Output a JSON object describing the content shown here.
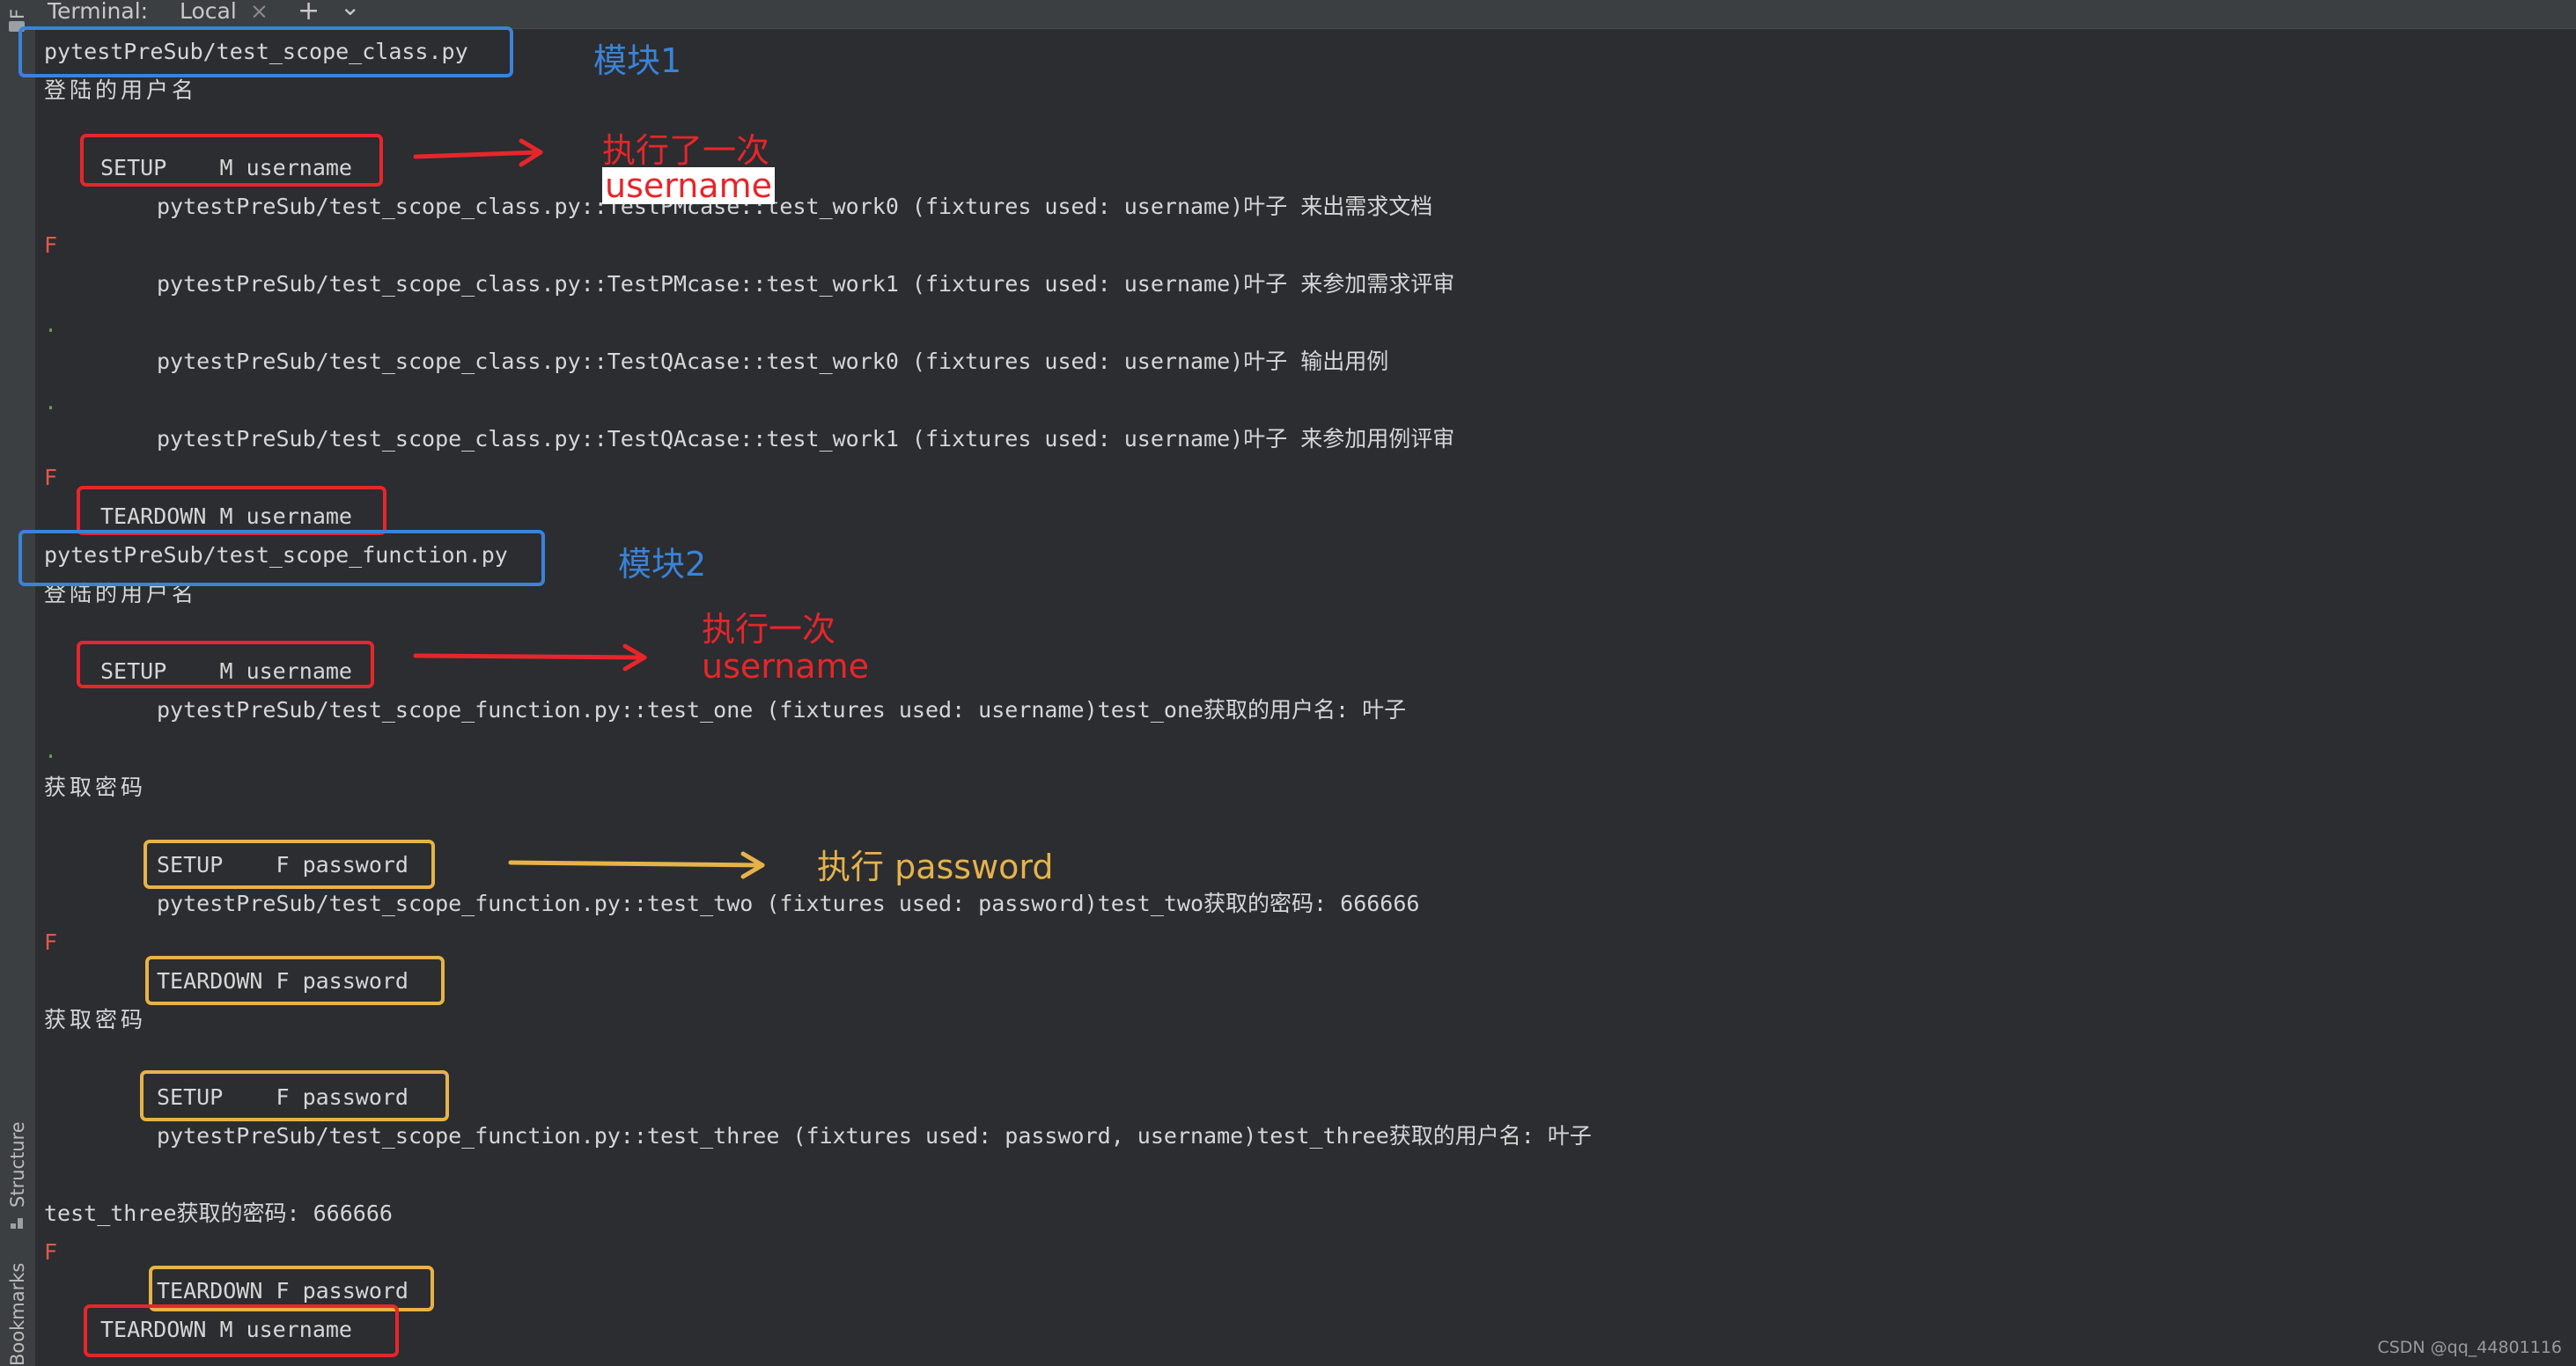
{
  "sidebar": {
    "top_label": "F",
    "structure_label": "Structure",
    "bookmarks_label": "Bookmarks"
  },
  "tool_tabs": {
    "terminal_label": "Terminal:",
    "local_tab_label": "Local",
    "close_glyph": "×",
    "add_glyph": "+",
    "dropdown_glyph": "⌄"
  },
  "terminal": {
    "line_module1": "pytestPreSub/test_scope_class.py",
    "line_login_user_1": "登陆的用户名",
    "line_setup_m_1": "SETUP    M username",
    "line_pm_work0": "pytestPreSub/test_scope_class.py::TestPMcase::test_work0 (fixtures used: username)叶子 来出需求文档",
    "line_f_1": "F",
    "line_pm_work1": "pytestPreSub/test_scope_class.py::TestPMcase::test_work1 (fixtures used: username)叶子 来参加需求评审",
    "line_dot_1": ".",
    "line_qa_work0": "pytestPreSub/test_scope_class.py::TestQAcase::test_work0 (fixtures used: username)叶子 输出用例",
    "line_dot_2": ".",
    "line_qa_work1": "pytestPreSub/test_scope_class.py::TestQAcase::test_work1 (fixtures used: username)叶子 来参加用例评审",
    "line_f_2": "F",
    "line_teardown_m_1": "TEARDOWN M username",
    "line_module2": "pytestPreSub/test_scope_function.py",
    "line_login_user_2": "登陆的用户名",
    "line_setup_m_2": "SETUP    M username",
    "line_test_one": "pytestPreSub/test_scope_function.py::test_one (fixtures used: username)test_one获取的用户名: 叶子",
    "line_dot_3": ".",
    "line_get_pwd_1": "获取密码",
    "line_setup_f_1": "SETUP    F password",
    "line_test_two": "pytestPreSub/test_scope_function.py::test_two (fixtures used: password)test_two获取的密码: 666666",
    "line_f_3": "F",
    "line_teardown_f_1": "TEARDOWN F password",
    "line_get_pwd_2": "获取密码",
    "line_setup_f_2": "SETUP    F password",
    "line_test_three": "pytestPreSub/test_scope_function.py::test_three (fixtures used: password, username)test_three获取的用户名: 叶子",
    "line_three_pwd": "test_three获取的密码: 666666",
    "line_f_4": "F",
    "line_teardown_f_2": "TEARDOWN F password",
    "line_teardown_m_2": "TEARDOWN M username"
  },
  "annotations": {
    "module1": "模块1",
    "module2": "模块2",
    "executed_once_1": "执行了一次",
    "username_1": "username",
    "executed_once_2": "执行一次",
    "username_2": "username",
    "execute_password": "执行 password"
  },
  "colors": {
    "blue": "#3b82d8",
    "red": "#e6262b",
    "yellow": "#e6b24a",
    "fail": "#e0584d",
    "pass_dot": "#6e9a57"
  },
  "watermark": "CSDN @qq_44801116"
}
